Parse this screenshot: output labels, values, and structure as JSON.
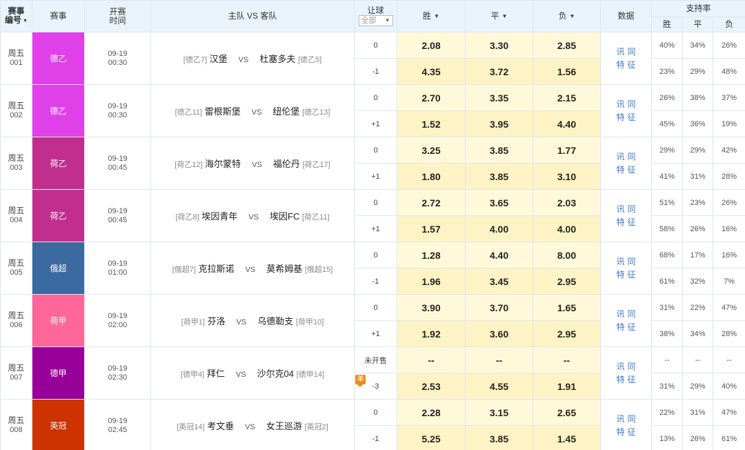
{
  "header": {
    "match_no": "赛事\n编号",
    "match_no_l1": "赛事",
    "match_no_l2": "编号",
    "league": "赛事",
    "time_l1": "开赛",
    "time_l2": "时间",
    "teams": "主队 VS 客队",
    "handicap": "让球",
    "handicap_select": "全部",
    "win": "胜",
    "draw": "平",
    "lose": "负",
    "data": "数据",
    "support": "支持率",
    "support_win": "胜",
    "support_draw": "平",
    "support_lose": "负",
    "sort_arrow": "▼"
  },
  "vs_text": "VS",
  "data_links": {
    "xun": "讯",
    "tong": "同",
    "te": "特",
    "zheng": "征"
  },
  "colors": {
    "header_bg": "#e9f3fb",
    "odds_bg": "#fff9d9",
    "link": "#3b78c3",
    "dan_badge": "#f08a1a"
  },
  "matches": [
    {
      "day": "周五",
      "num": "001",
      "league": "德乙",
      "league_color": "#e040e8",
      "date": "09-19",
      "time": "00:30",
      "home_rank": "[德乙7]",
      "home": "汉堡",
      "away": "杜塞多夫",
      "away_rank": "[德乙5]",
      "hc1": "0",
      "o1": [
        "2.08",
        "3.30",
        "2.85"
      ],
      "hc2": "-1",
      "o2": [
        "4.35",
        "3.72",
        "1.56"
      ],
      "s1": [
        "40%",
        "34%",
        "26%"
      ],
      "s2": [
        "23%",
        "29%",
        "48%"
      ]
    },
    {
      "day": "周五",
      "num": "002",
      "league": "德乙",
      "league_color": "#e040e8",
      "date": "09-19",
      "time": "00:30",
      "home_rank": "[德乙11]",
      "home": "雷根斯堡",
      "away": "纽伦堡",
      "away_rank": "[德乙13]",
      "hc1": "0",
      "o1": [
        "2.70",
        "3.35",
        "2.15"
      ],
      "hc2": "+1",
      "o2": [
        "1.52",
        "3.95",
        "4.40"
      ],
      "s1": [
        "26%",
        "38%",
        "37%"
      ],
      "s2": [
        "45%",
        "36%",
        "19%"
      ]
    },
    {
      "day": "周五",
      "num": "003",
      "league": "荷乙",
      "league_color": "#c12f8d",
      "date": "09-19",
      "time": "00:45",
      "home_rank": "[荷乙12]",
      "home": "海尔蒙特",
      "away": "福伦丹",
      "away_rank": "[荷乙17]",
      "hc1": "0",
      "o1": [
        "3.25",
        "3.85",
        "1.77"
      ],
      "hc2": "+1",
      "o2": [
        "1.80",
        "3.85",
        "3.10"
      ],
      "s1": [
        "29%",
        "29%",
        "42%"
      ],
      "s2": [
        "41%",
        "31%",
        "28%"
      ]
    },
    {
      "day": "周五",
      "num": "004",
      "league": "荷乙",
      "league_color": "#c12f8d",
      "date": "09-19",
      "time": "00:45",
      "home_rank": "[荷乙8]",
      "home": "埃因青年",
      "away": "埃因FC",
      "away_rank": "[荷乙11]",
      "hc1": "0",
      "o1": [
        "2.72",
        "3.65",
        "2.03"
      ],
      "hc2": "+1",
      "o2": [
        "1.57",
        "4.00",
        "4.00"
      ],
      "s1": [
        "51%",
        "23%",
        "26%"
      ],
      "s2": [
        "58%",
        "26%",
        "16%"
      ]
    },
    {
      "day": "周五",
      "num": "005",
      "league": "俄超",
      "league_color": "#3a6aa0",
      "date": "09-19",
      "time": "01:00",
      "home_rank": "[俄超7]",
      "home": "克拉斯诺",
      "away": "莫希姆基",
      "away_rank": "[俄超15]",
      "hc1": "0",
      "o1": [
        "1.28",
        "4.40",
        "8.00"
      ],
      "hc2": "-1",
      "o2": [
        "1.96",
        "3.45",
        "2.95"
      ],
      "s1": [
        "68%",
        "17%",
        "16%"
      ],
      "s2": [
        "61%",
        "32%",
        "7%"
      ]
    },
    {
      "day": "周五",
      "num": "006",
      "league": "荷甲",
      "league_color": "#ff6699",
      "date": "09-19",
      "time": "02:00",
      "home_rank": "[荷甲1]",
      "home": "芬洛",
      "away": "乌德勒支",
      "away_rank": "[荷甲10]",
      "hc1": "0",
      "o1": [
        "3.90",
        "3.70",
        "1.65"
      ],
      "hc2": "+1",
      "o2": [
        "1.92",
        "3.60",
        "2.95"
      ],
      "s1": [
        "31%",
        "22%",
        "47%"
      ],
      "s2": [
        "38%",
        "34%",
        "28%"
      ]
    },
    {
      "day": "周五",
      "num": "007",
      "league": "德甲",
      "league_color": "#980199",
      "date": "09-19",
      "time": "02:30",
      "home_rank": "[德甲4]",
      "home": "拜仁",
      "away": "沙尔克04",
      "away_rank": "[德甲14]",
      "hc1": "未开售",
      "o1": [
        "--",
        "--",
        "--"
      ],
      "hc2": "-3",
      "dan": "单",
      "o2": [
        "2.53",
        "4.55",
        "1.91"
      ],
      "s1": [
        "--",
        "--",
        "--"
      ],
      "s2": [
        "31%",
        "29%",
        "40%"
      ]
    },
    {
      "day": "周五",
      "num": "008",
      "league": "英冠",
      "league_color": "#cc3300",
      "date": "09-19",
      "time": "02:45",
      "home_rank": "[英冠14]",
      "home": "考文垂",
      "away": "女王巡游",
      "away_rank": "[英冠2]",
      "hc1": "0",
      "o1": [
        "2.28",
        "3.15",
        "2.65"
      ],
      "hc2": "-1",
      "o2": [
        "5.25",
        "3.85",
        "1.45"
      ],
      "s1": [
        "22%",
        "31%",
        "47%"
      ],
      "s2": [
        "13%",
        "26%",
        "61%"
      ]
    }
  ]
}
